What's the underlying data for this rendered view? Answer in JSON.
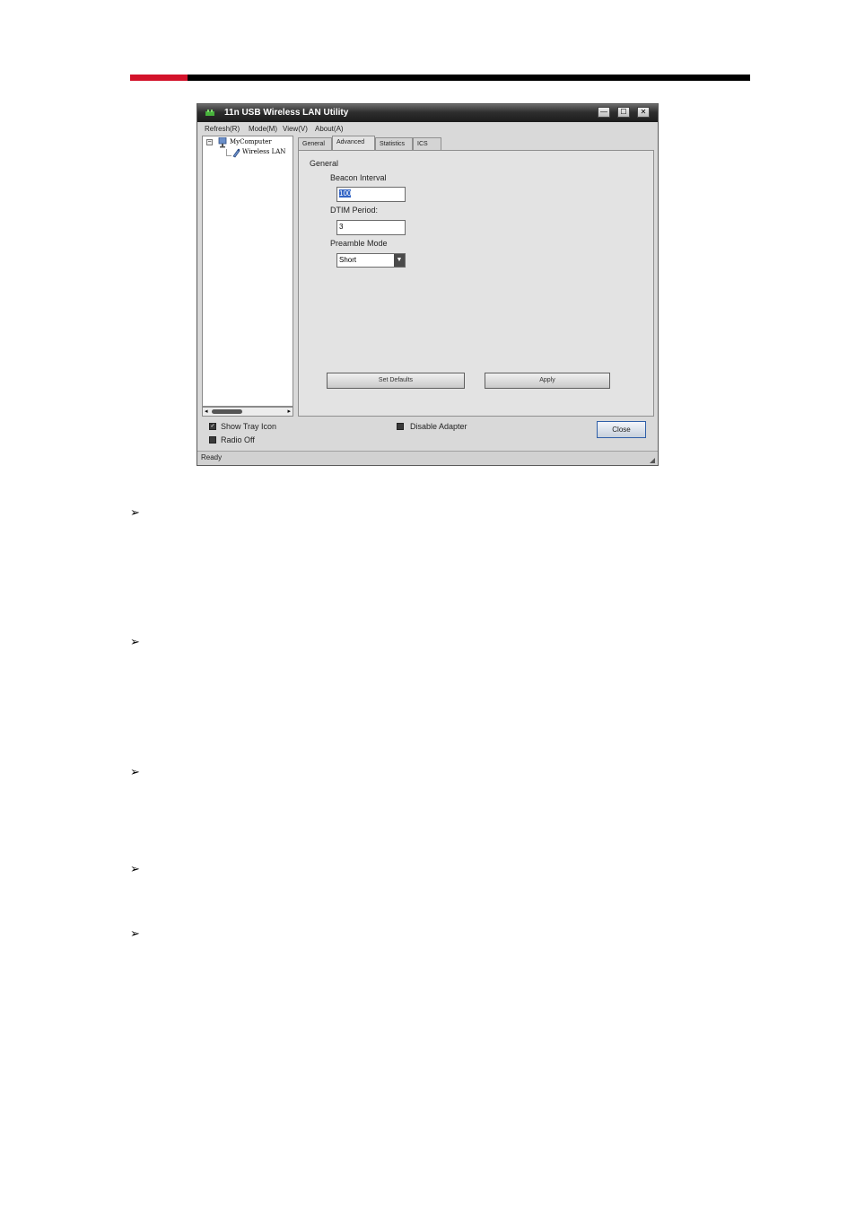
{
  "window": {
    "title": "11n USB Wireless LAN Utility",
    "buttons": {
      "minimize": "—",
      "maximize": "☐",
      "close": "✕"
    }
  },
  "menu": [
    "Refresh(R)",
    "Mode(M)",
    "View(V)",
    "About(A)"
  ],
  "tree": {
    "root": "MyComputer",
    "child": "Wireless LAN"
  },
  "tabs": [
    "General",
    "Advanced",
    "Statistics",
    "ICS"
  ],
  "active_tab": "Advanced",
  "panel": {
    "section_label": "General",
    "beacon_label": "Beacon Interval",
    "beacon_value": "100",
    "dtim_label": "DTIM Period:",
    "dtim_value": "3",
    "preamble_label": "Preamble Mode",
    "preamble_value": "Short",
    "set_defaults": "Set Defaults",
    "apply": "Apply"
  },
  "options": {
    "show_tray_icon": "Show Tray Icon",
    "radio_off": "Radio Off",
    "disable_adapter": "Disable Adapter",
    "close": "Close"
  },
  "status": "Ready",
  "bullet_glyph": "➢",
  "colors": {
    "accent": "#d3122a",
    "selection": "#3163c5"
  }
}
